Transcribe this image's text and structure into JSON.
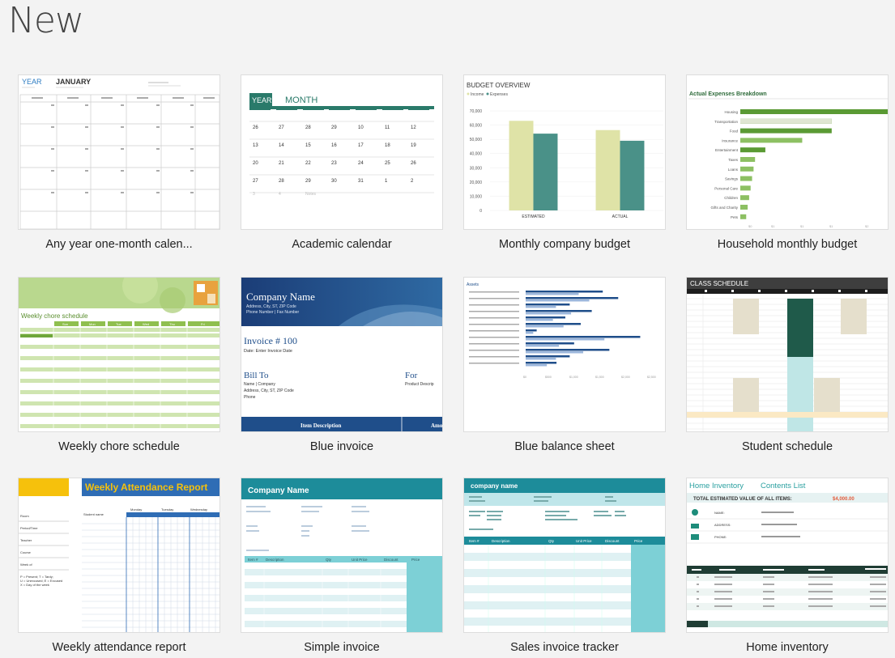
{
  "page": {
    "title": "New"
  },
  "templates": [
    {
      "name": "Any year one-month calen...",
      "preview": {
        "year": "YEAR",
        "month": "JANUARY"
      }
    },
    {
      "name": "Academic calendar",
      "preview": {
        "year": "YEAR",
        "month": "MONTH"
      }
    },
    {
      "name": "Monthly company budget",
      "preview": {
        "title": "BUDGET OVERVIEW",
        "legend": [
          "Income",
          "Expenses"
        ],
        "chart_data": {
          "type": "bar",
          "categories": [
            "ESTIMATED",
            "ACTUAL"
          ],
          "series": [
            {
              "name": "Income",
              "values": [
                63000,
                56500
              ]
            },
            {
              "name": "Expenses",
              "values": [
                54000,
                49000
              ]
            }
          ],
          "yticks": [
            "0",
            "10,000",
            "20,000",
            "30,000",
            "40,000",
            "50,000",
            "60,000",
            "70,000"
          ],
          "ylim": [
            0,
            70000
          ]
        }
      }
    },
    {
      "name": "Household monthly budget",
      "preview": {
        "title": "Actual Expenses Breakdown",
        "chart_data": {
          "type": "bar",
          "categories": [
            "Housing",
            "Transportation",
            "Food",
            "Insurance",
            "Entertainment",
            "Taxes",
            "Loans",
            "Savings",
            "Personal Care",
            "Children",
            "Gifts and Charity",
            "Pets"
          ],
          "values": [
            1.0,
            0.62,
            0.62,
            0.42,
            0.17,
            0.1,
            0.09,
            0.08,
            0.07,
            0.06,
            0.05,
            0.04
          ]
        }
      }
    },
    {
      "name": "Weekly chore schedule",
      "preview": {
        "title": "Weekly chore schedule",
        "days": [
          "Sun",
          "Mon",
          "Tue",
          "Wed",
          "Thu",
          "Fri"
        ]
      }
    },
    {
      "name": "Blue invoice",
      "preview": {
        "company": "Company Name",
        "address": "Address, City, ST, ZIP Code",
        "phone": "Phone Number | Fax Number",
        "invoice_no": "Invoice # 100",
        "date": "Date: Enter Invoice Date",
        "bill_to": "Bill To",
        "bill_to_lines": [
          "Name | Company",
          "Address, City, ST, ZIP Code",
          "Phone"
        ],
        "for": "For",
        "for_line": "Product Descrip",
        "col1": "Item Description",
        "col2": "Amo"
      }
    },
    {
      "name": "Blue balance sheet",
      "preview": {
        "title": "Assets",
        "chart_data": {
          "type": "bar",
          "values": [
            0.35,
            0.42,
            0.2,
            0.3,
            0.18,
            0.25,
            0.05,
            0.52,
            0.22,
            0.38,
            0.2,
            0.14
          ]
        }
      }
    },
    {
      "name": "Student schedule",
      "preview": {
        "title": "CLASS SCHEDULE"
      }
    },
    {
      "name": "Weekly attendance report",
      "preview": {
        "title": "Weekly Attendance Report",
        "days": [
          "Monday",
          "Tuesday",
          "Wednesday"
        ],
        "col": "Student name",
        "fields": [
          "Room",
          "Period/Time",
          "Teacher",
          "Course",
          "Week of"
        ],
        "legend": [
          "P = Present; T = Tardy;",
          "U = Unexcused; E = Excused",
          "X = Day of the week"
        ]
      }
    },
    {
      "name": "Simple invoice",
      "preview": {
        "company": "Company Name",
        "cols": [
          "Item #",
          "Description",
          "Qty",
          "Unit Price",
          "Discount",
          "Price"
        ]
      }
    },
    {
      "name": "Sales invoice tracker",
      "preview": {
        "company": "company name",
        "cols": [
          "Item #",
          "Description",
          "Qty",
          "Unit Price",
          "Discount",
          "Price"
        ]
      }
    },
    {
      "name": "Home inventory",
      "preview": {
        "tab1": "Home Inventory",
        "tab2": "Contents List",
        "total_label": "TOTAL ESTIMATED VALUE OF ALL ITEMS:",
        "total_value": "$4,000.00",
        "fields": [
          "NAME:",
          "ADDRESS:",
          "PHONE:"
        ]
      }
    }
  ]
}
